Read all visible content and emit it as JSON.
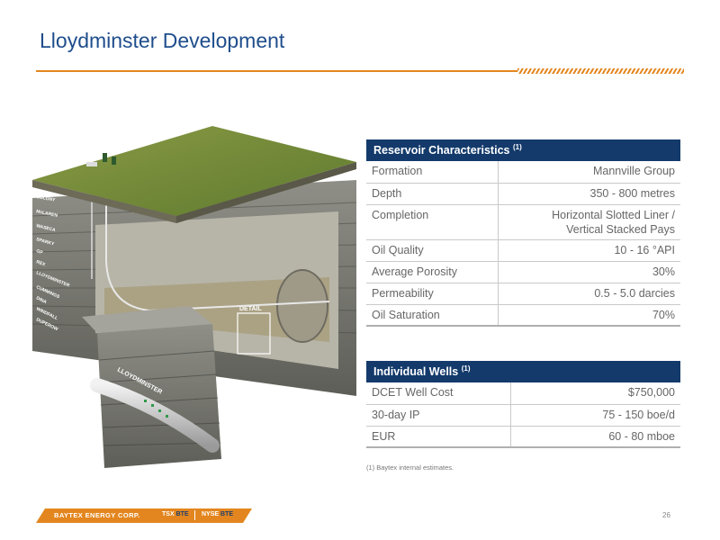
{
  "title": "Lloydminster Development",
  "illustration": {
    "formations": [
      "COLONY",
      "McLAREN",
      "WASECA",
      "SPARKY",
      "GP",
      "REX",
      "LLOYDMINSTER",
      "CUMMINGS",
      "DINA",
      "WINDFALL",
      "DUPEROW"
    ],
    "detail_label": "DETAIL",
    "pipe_label": "LLOYDMINSTER"
  },
  "reservoir": {
    "header": "Reservoir Characteristics",
    "header_note": "(1)",
    "rows": [
      {
        "label": "Formation",
        "value": "Mannville Group"
      },
      {
        "label": "Depth",
        "value": "350 - 800 metres"
      },
      {
        "label": "Completion",
        "value": "Horizontal Slotted Liner /",
        "value2": "Vertical  Stacked Pays"
      },
      {
        "label": "Oil Quality",
        "value": "10 - 16 °API"
      },
      {
        "label": "Average Porosity",
        "value": "30%"
      },
      {
        "label": "Permeability",
        "value": "0.5 - 5.0 darcies"
      },
      {
        "label": "Oil Saturation",
        "value": "70%"
      }
    ]
  },
  "wells": {
    "header": "Individual Wells",
    "header_note": "(1)",
    "rows": [
      {
        "label": "DCET Well Cost",
        "value": "$750,000"
      },
      {
        "label": "30-day IP",
        "value": "75 - 150 boe/d"
      },
      {
        "label": "EUR",
        "value": "60 - 80 mboe"
      }
    ]
  },
  "footnote": "(1)    Baytex internal estimates.",
  "footer": {
    "company": "BAYTEX ENERGY CORP.",
    "tsx_prefix": "TSX",
    "tsx_ticker": "BTE",
    "nyse_prefix": "NYSE",
    "nyse_ticker": "BTE",
    "page_number": "26"
  },
  "colors": {
    "title": "#1f4e8c",
    "accent": "#e3861f",
    "table_header": "#133a6b"
  }
}
